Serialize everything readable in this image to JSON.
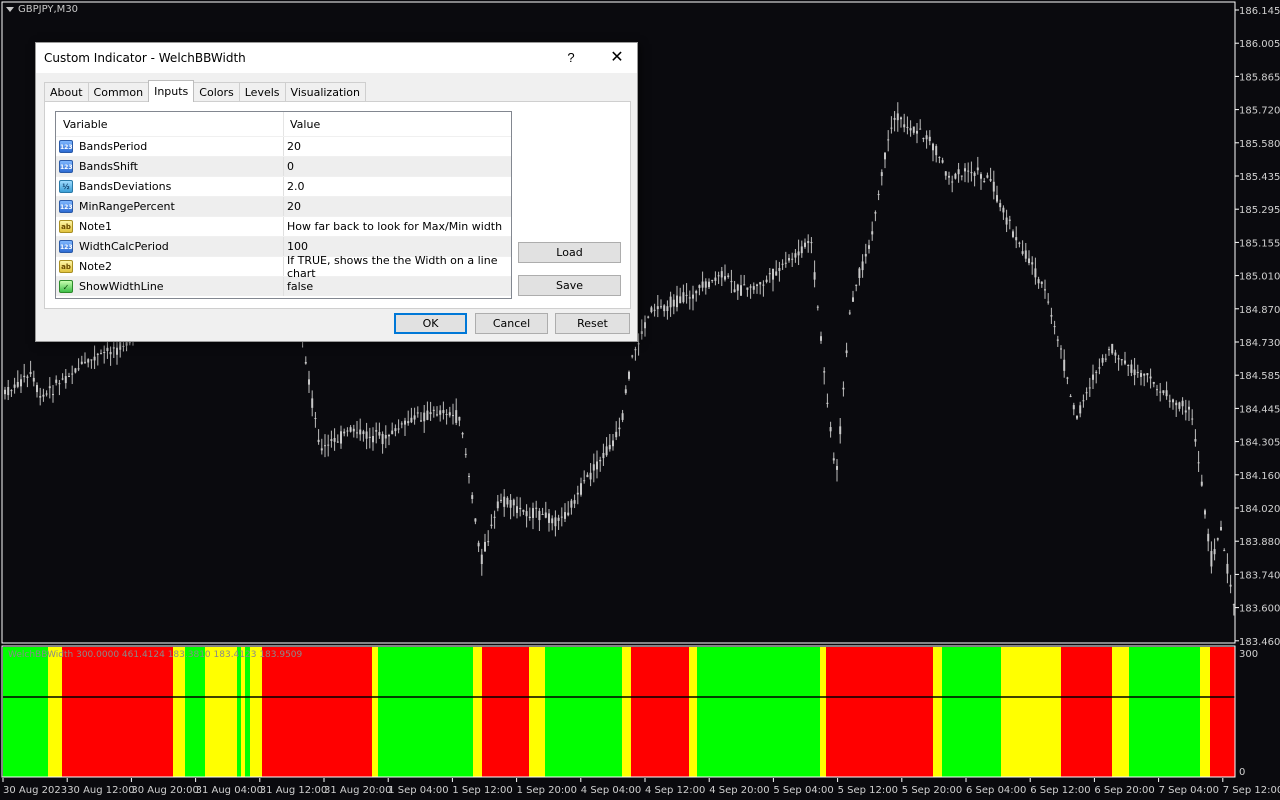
{
  "chart": {
    "symbol_label": "GBPJPY,M30",
    "price_levels": [
      "186.145",
      "186.005",
      "185.865",
      "185.720",
      "185.580",
      "185.435",
      "185.295",
      "185.155",
      "185.010",
      "184.870",
      "184.730",
      "184.585",
      "184.445",
      "184.305",
      "184.160",
      "184.020",
      "183.880",
      "183.740",
      "183.600",
      "183.460"
    ],
    "colors": {
      "background": "#0a0a0e",
      "candle": "#c8c8c8",
      "grid": "#ffffff"
    }
  },
  "indicator": {
    "label": "WelchBBWidth 300.0000 461.4124 183.3810 183.4123 183.9509",
    "scale_top": "300",
    "scale_bottom": "0",
    "colors": {
      "green": "#00ff00",
      "red": "#ff0000",
      "yellow": "#ffff00"
    }
  },
  "time_axis": {
    "labels": [
      "30 Aug 2023",
      "30 Aug 12:00",
      "30 Aug 20:00",
      "31 Aug 04:00",
      "31 Aug 12:00",
      "31 Aug 20:00",
      "1 Sep 04:00",
      "1 Sep 12:00",
      "1 Sep 20:00",
      "4 Sep 04:00",
      "4 Sep 12:00",
      "4 Sep 20:00",
      "5 Sep 04:00",
      "5 Sep 12:00",
      "5 Sep 20:00",
      "6 Sep 04:00",
      "6 Sep 12:00",
      "6 Sep 20:00",
      "7 Sep 04:00",
      "7 Sep 12:00"
    ]
  },
  "dialog": {
    "title": "Custom Indicator - WelchBBWidth",
    "help_label": "?",
    "close_label": "✕",
    "tabs": [
      {
        "label": "About",
        "active": false
      },
      {
        "label": "Common",
        "active": false
      },
      {
        "label": "Inputs",
        "active": true
      },
      {
        "label": "Colors",
        "active": false
      },
      {
        "label": "Levels",
        "active": false
      },
      {
        "label": "Visualization",
        "active": false
      }
    ],
    "grid": {
      "header_variable": "Variable",
      "header_value": "Value",
      "rows": [
        {
          "icon": "number-icon",
          "icon_text": "123",
          "type": "num",
          "variable": "BandsPeriod",
          "value": "20"
        },
        {
          "icon": "number-icon",
          "icon_text": "123",
          "type": "num",
          "variable": "BandsShift",
          "value": "0"
        },
        {
          "icon": "double-icon",
          "icon_text": "½",
          "type": "dbl",
          "variable": "BandsDeviations",
          "value": "2.0"
        },
        {
          "icon": "number-icon",
          "icon_text": "123",
          "type": "num",
          "variable": "MinRangePercent",
          "value": "20"
        },
        {
          "icon": "string-icon",
          "icon_text": "ab",
          "type": "str",
          "variable": "Note1",
          "value": "How far back to look for Max/Min width"
        },
        {
          "icon": "number-icon",
          "icon_text": "123",
          "type": "num",
          "variable": "WidthCalcPeriod",
          "value": "100"
        },
        {
          "icon": "string-icon",
          "icon_text": "ab",
          "type": "str",
          "variable": "Note2",
          "value": "If TRUE, shows the the Width on a line chart"
        },
        {
          "icon": "bool-icon",
          "icon_text": "✓",
          "type": "bool",
          "variable": "ShowWidthLine",
          "value": "false"
        }
      ]
    },
    "buttons": {
      "load": "Load",
      "save": "Save",
      "ok": "OK",
      "cancel": "Cancel",
      "reset": "Reset"
    }
  }
}
